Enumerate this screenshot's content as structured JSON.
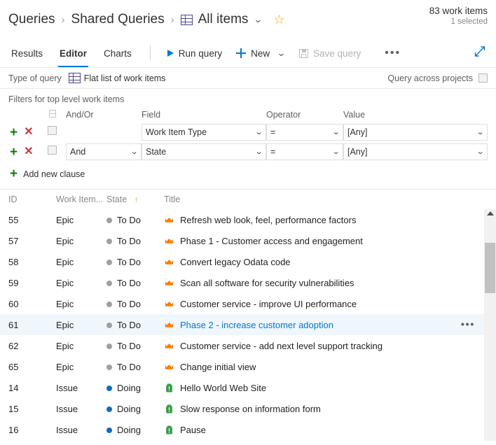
{
  "header": {
    "breadcrumb": [
      {
        "label": "Queries"
      },
      {
        "label": "Shared Queries"
      },
      {
        "label": "All items"
      }
    ],
    "separator": "›",
    "grid_icon": "table-icon",
    "chevron_icon": "chevron-down-icon",
    "favorite_icon": "star-icon",
    "favorite_color": "#e8a317",
    "count_main": "83 work items",
    "count_sub": "1 selected"
  },
  "toolbar": {
    "tabs": [
      {
        "label": "Results",
        "active": false
      },
      {
        "label": "Editor",
        "active": true
      },
      {
        "label": "Charts",
        "active": false
      }
    ],
    "run_query_label": "Run query",
    "run_query_icon": "play-icon",
    "new_label": "New",
    "new_icon": "plus-icon",
    "new_chevron": "chevron-down-icon",
    "save_query_label": "Save query",
    "save_query_icon": "save-icon",
    "save_query_disabled": true,
    "more_label": "•••",
    "more_icon": "ellipsis-icon",
    "expand_icon": "fullscreen-expand-icon",
    "accent_color": "#0078d4"
  },
  "query_type": {
    "label": "Type of query",
    "icon": "flat-list-icon",
    "value": "Flat list of work items",
    "across_projects_label": "Query across projects",
    "across_projects_checked": false
  },
  "filters": {
    "title": "Filters for top level work items",
    "columns": {
      "select_icon": "select-rows-icon",
      "andor": "And/Or",
      "field": "Field",
      "operator": "Operator",
      "value": "Value"
    },
    "add_icon": "plus-icon",
    "delete_icon": "close-icon",
    "rows": [
      {
        "andor": "",
        "field": "Work Item Type",
        "operator": "=",
        "value": "[Any]",
        "checked": false
      },
      {
        "andor": "And",
        "field": "State",
        "operator": "=",
        "value": "[Any]",
        "checked": false
      }
    ],
    "add_clause_label": "Add new clause"
  },
  "grid": {
    "columns": [
      {
        "label": "ID"
      },
      {
        "label": "Work Item..."
      },
      {
        "label": "State",
        "sorted": true,
        "sort_icon": "arrow-up-icon"
      },
      {
        "label": "Title"
      }
    ],
    "state_colors": {
      "To Do": "#a19f9d",
      "Doing": "#0f6cbd"
    },
    "rows": [
      {
        "id": "55",
        "type": "Epic",
        "state": "To Do",
        "title": "Refresh web look, feel, performance factors",
        "icon": "epic-crown-icon",
        "selected": false
      },
      {
        "id": "57",
        "type": "Epic",
        "state": "To Do",
        "title": "Phase 1 - Customer access and engagement",
        "icon": "epic-crown-icon",
        "selected": false
      },
      {
        "id": "58",
        "type": "Epic",
        "state": "To Do",
        "title": "Convert legacy Odata code",
        "icon": "epic-crown-icon",
        "selected": false
      },
      {
        "id": "59",
        "type": "Epic",
        "state": "To Do",
        "title": "Scan all software for security vulnerabilities",
        "icon": "epic-crown-icon",
        "selected": false
      },
      {
        "id": "60",
        "type": "Epic",
        "state": "To Do",
        "title": "Customer service - improve UI performance",
        "icon": "epic-crown-icon",
        "selected": false
      },
      {
        "id": "61",
        "type": "Epic",
        "state": "To Do",
        "title": "Phase 2 - increase customer adoption",
        "icon": "epic-crown-icon",
        "selected": true
      },
      {
        "id": "62",
        "type": "Epic",
        "state": "To Do",
        "title": "Customer service - add next level support tracking",
        "icon": "epic-crown-icon",
        "selected": false
      },
      {
        "id": "65",
        "type": "Epic",
        "state": "To Do",
        "title": "Change initial view",
        "icon": "epic-crown-icon",
        "selected": false
      },
      {
        "id": "14",
        "type": "Issue",
        "state": "Doing",
        "title": "Hello World Web Site",
        "icon": "issue-icon",
        "selected": false
      },
      {
        "id": "15",
        "type": "Issue",
        "state": "Doing",
        "title": "Slow response on information form",
        "icon": "issue-icon",
        "selected": false
      },
      {
        "id": "16",
        "type": "Issue",
        "state": "Doing",
        "title": "Pause",
        "icon": "issue-icon",
        "selected": false
      }
    ],
    "row_menu_icon": "ellipsis-icon",
    "row_menu_label": "•••",
    "epic_icon_color": "#ff7b00",
    "issue_icon_color": "#339947"
  }
}
